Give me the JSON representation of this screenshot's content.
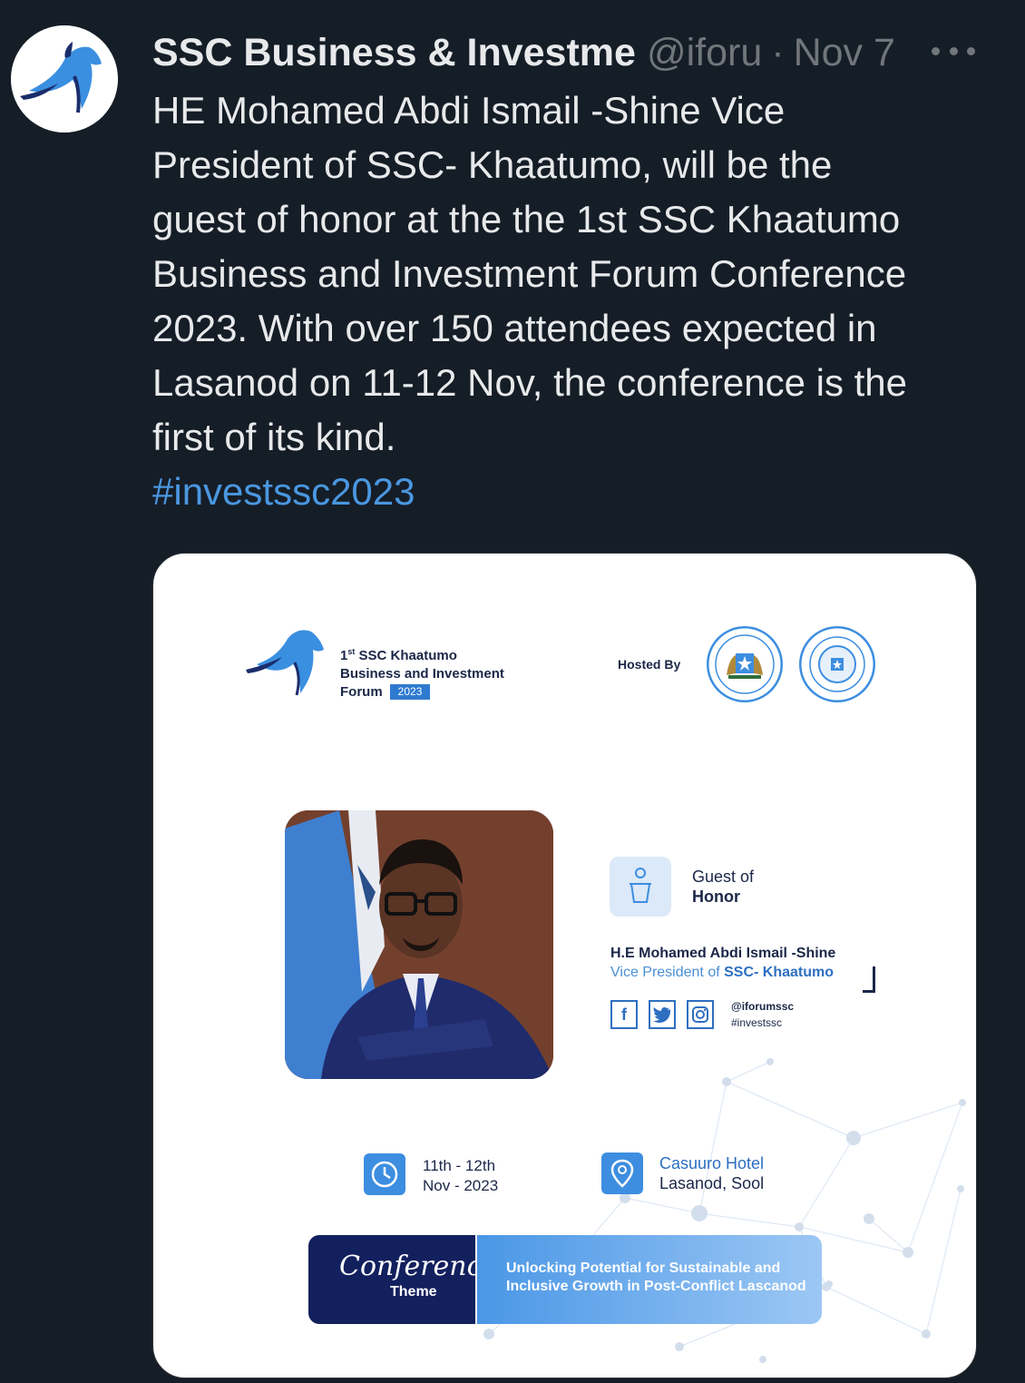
{
  "post": {
    "author_name": "SSC Business & Investme",
    "handle": "@iforu",
    "separator": "·",
    "date": "Nov 7",
    "more_icon": "ellipsis-icon",
    "text": "HE Mohamed Abdi Ismail -Shine Vice\nPresident of SSC- Khaatumo, will be the\nguest of honor at the the 1st SSC Khaatumo\nBusiness and Investment Forum Conference\n2023. With over 150 attendees expected in\nLasanod on 11-12 Nov, the conference is the\nfirst of its kind.",
    "hashtag": "#investssc2023"
  },
  "poster": {
    "forum_line1_sup": "st",
    "forum_line1_num": "1",
    "forum_line1_rest": " SSC Khaatumo",
    "forum_line2": "Business and Investment",
    "forum_line3": "Forum",
    "forum_year": "2023",
    "hosted_by": "Hosted By",
    "guest_of": "Guest of",
    "guest_honor": "Honor",
    "guest_name": "H.E Mohamed Abdi Ismail -Shine",
    "guest_role_prefix": "Vice President of ",
    "guest_role_org": "SSC- Khaatumo",
    "social_handle": "@iforumssc",
    "social_tag": "#investssc",
    "date_line1": "11th - 12th",
    "date_line2": "Nov - 2023",
    "venue": "Casuuro Hotel",
    "venue_location": "Lasanod, Sool",
    "theme_script": "Conference",
    "theme_word": "Theme",
    "theme_line1": "Unlocking Potential for Sustainable and",
    "theme_line2": "Inclusive Growth in Post-Conflict Lascanod"
  },
  "colors": {
    "background": "#151d27",
    "text": "#e7e9ea",
    "muted": "#71767b",
    "link": "#4a97e0",
    "poster_navy": "#13205e",
    "poster_blue": "#3d8ee0"
  }
}
